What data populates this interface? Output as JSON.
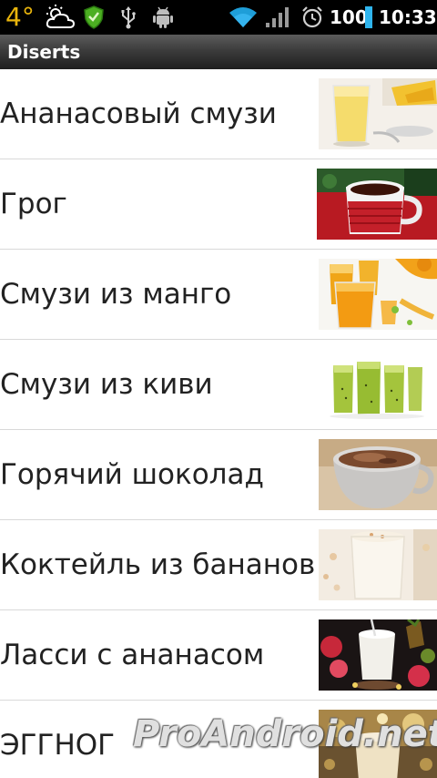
{
  "status_bar": {
    "temperature": "4°",
    "battery": "100",
    "time": "10:33",
    "icons": [
      "weather-cloud-sun-icon",
      "shield-icon",
      "usb-icon",
      "android-debug-icon",
      "wifi-icon",
      "signal-icon",
      "alarm-icon",
      "battery-icon"
    ],
    "accent_color": "#e8b40c"
  },
  "title_bar": {
    "title": "Diserts"
  },
  "list": {
    "items": [
      {
        "label": "Ананасовый смузи"
      },
      {
        "label": "Грог"
      },
      {
        "label": "Смузи из манго"
      },
      {
        "label": "Смузи из киви"
      },
      {
        "label": "Горячий шоколад"
      },
      {
        "label": "Коктейль из бананов"
      },
      {
        "label": "Ласси с ананасом"
      },
      {
        "label": "ЭГГНОГ"
      }
    ]
  },
  "watermark": {
    "text": "ProAndroid.net"
  }
}
